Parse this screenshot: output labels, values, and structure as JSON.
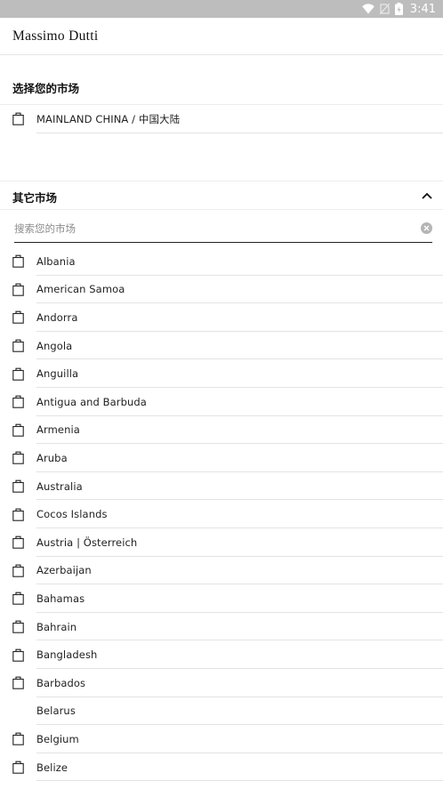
{
  "status_bar": {
    "time": "3:41",
    "icons": [
      "wifi-icon",
      "no-sim-icon",
      "battery-icon"
    ]
  },
  "header": {
    "brand": "Massimo Dutti"
  },
  "selected_market": {
    "title": "选择您的市场",
    "item": {
      "label": "MAINLAND CHINA / 中国大陆",
      "icon": "shopping-bag-icon"
    }
  },
  "other_markets": {
    "title": "其它市场",
    "expanded_icon": "chevron-up-icon",
    "search": {
      "placeholder": "搜索您的市场",
      "value": ""
    },
    "items": [
      {
        "label": "Albania",
        "icon": true
      },
      {
        "label": "American Samoa",
        "icon": true
      },
      {
        "label": "Andorra",
        "icon": true
      },
      {
        "label": "Angola",
        "icon": true
      },
      {
        "label": "Anguilla",
        "icon": true
      },
      {
        "label": "Antigua and Barbuda",
        "icon": true
      },
      {
        "label": "Armenia",
        "icon": true
      },
      {
        "label": "Aruba",
        "icon": true
      },
      {
        "label": "Australia",
        "icon": true
      },
      {
        "label": "Cocos Islands",
        "icon": true
      },
      {
        "label": "Austria | Österreich",
        "icon": true
      },
      {
        "label": "Azerbaijan",
        "icon": true
      },
      {
        "label": "Bahamas",
        "icon": true
      },
      {
        "label": "Bahrain",
        "icon": true
      },
      {
        "label": "Bangladesh",
        "icon": true
      },
      {
        "label": "Barbados",
        "icon": true
      },
      {
        "label": "Belarus",
        "icon": false
      },
      {
        "label": "Belgium",
        "icon": true
      },
      {
        "label": "Belize",
        "icon": true
      }
    ]
  }
}
